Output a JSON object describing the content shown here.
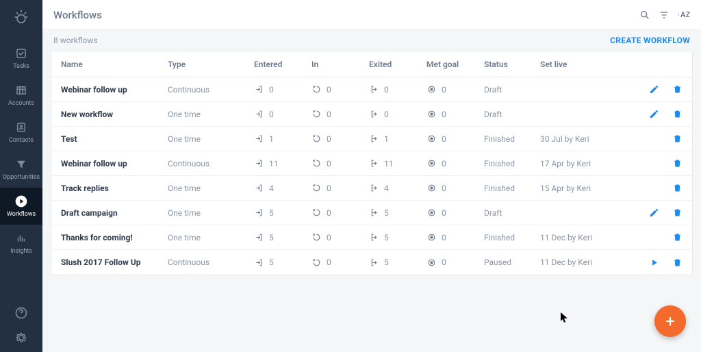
{
  "sidebar": {
    "items": [
      {
        "label": "Tasks"
      },
      {
        "label": "Accounts"
      },
      {
        "label": "Contacts"
      },
      {
        "label": "Opportunities"
      },
      {
        "label": "Workflows"
      },
      {
        "label": "Insights"
      }
    ]
  },
  "header": {
    "title": "Workflows",
    "sort_label": "AZ"
  },
  "subhead": {
    "count": "8 workflows",
    "create": "CREATE WORKFLOW"
  },
  "columns": {
    "name": "Name",
    "type": "Type",
    "entered": "Entered",
    "in": "In",
    "exited": "Exited",
    "met_goal": "Met goal",
    "status": "Status",
    "set_live": "Set live"
  },
  "rows": [
    {
      "name": "Webinar follow up",
      "type": "Continuous",
      "entered": "0",
      "in": "0",
      "exited": "0",
      "met_goal": "0",
      "status": "Draft",
      "set_live": "",
      "edit": true,
      "play": false
    },
    {
      "name": "New workflow",
      "type": "One time",
      "entered": "0",
      "in": "0",
      "exited": "0",
      "met_goal": "0",
      "status": "Draft",
      "set_live": "",
      "edit": true,
      "play": false
    },
    {
      "name": "Test",
      "type": "One time",
      "entered": "1",
      "in": "0",
      "exited": "1",
      "met_goal": "0",
      "status": "Finished",
      "set_live": "30 Jul by Keri",
      "edit": false,
      "play": false
    },
    {
      "name": "Webinar follow up",
      "type": "Continuous",
      "entered": "11",
      "in": "0",
      "exited": "11",
      "met_goal": "0",
      "status": "Finished",
      "set_live": "17 Apr by Keri",
      "edit": false,
      "play": false
    },
    {
      "name": "Track replies",
      "type": "One time",
      "entered": "4",
      "in": "0",
      "exited": "4",
      "met_goal": "0",
      "status": "Finished",
      "set_live": "15 Apr by Keri",
      "edit": false,
      "play": false
    },
    {
      "name": "Draft campaign",
      "type": "One time",
      "entered": "5",
      "in": "0",
      "exited": "5",
      "met_goal": "0",
      "status": "Draft",
      "set_live": "",
      "edit": true,
      "play": false
    },
    {
      "name": "Thanks for coming!",
      "type": "One time",
      "entered": "5",
      "in": "0",
      "exited": "5",
      "met_goal": "0",
      "status": "Finished",
      "set_live": "11 Dec by Keri",
      "edit": false,
      "play": false
    },
    {
      "name": "Slush 2017 Follow Up",
      "type": "Continuous",
      "entered": "5",
      "in": "0",
      "exited": "5",
      "met_goal": "0",
      "status": "Paused",
      "set_live": "11 Dec by Keri",
      "edit": false,
      "play": true
    }
  ]
}
